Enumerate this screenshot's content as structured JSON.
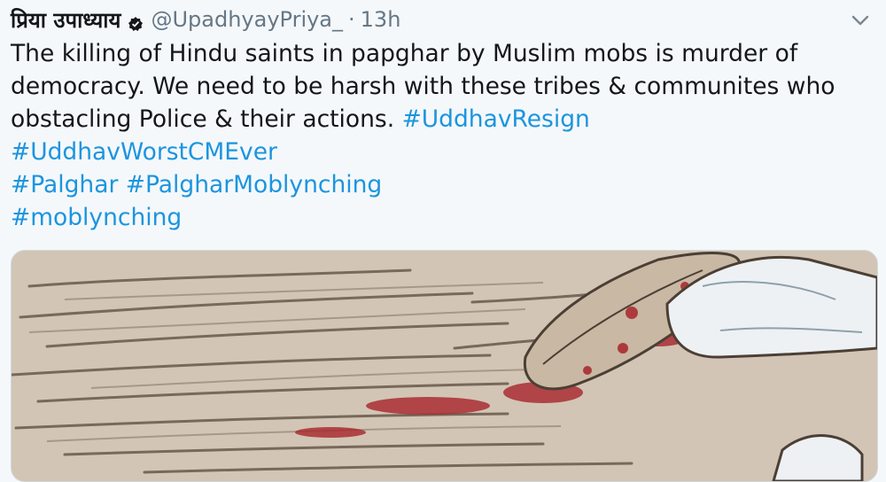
{
  "tweet": {
    "author_name": "प्रिया उपाध्याय",
    "verified_icon": "verified-badge-icon",
    "handle": "@UpadhyayPriya_",
    "separator": "·",
    "time": "13h",
    "menu_icon": "chevron-down-icon",
    "text": {
      "line1": "The killing of Hindu saints in papghar by Muslim mobs is murder of",
      "line2": "democracy. We need to be harsh with these tribes & communites who",
      "line3_text": "obstacling Police & their actions. ",
      "line3_tag": "#UddhavResign",
      "tag2": "#UddhavWorstCMEver",
      "tag3": "#Palghar",
      "tag4": "#PalgharMoblynching",
      "tag5": "#moblynching"
    },
    "media": {
      "icon": "illustration-image",
      "colors": {
        "ground": "#cbbba9",
        "blood": "#a8242b",
        "cloth": "#eef1f3"
      }
    }
  }
}
